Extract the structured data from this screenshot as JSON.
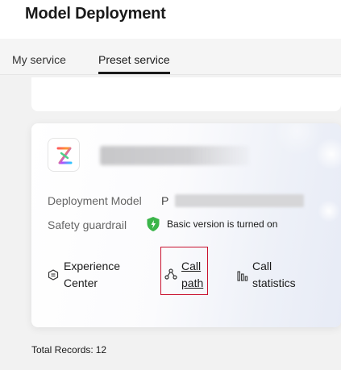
{
  "header": {
    "title": "Model Deployment"
  },
  "tabs": [
    {
      "label": "My service",
      "active": false
    },
    {
      "label": "Preset service",
      "active": true
    }
  ],
  "service_card": {
    "fields": {
      "deployment_model_label": "Deployment Model",
      "deployment_model_value_prefix": "P",
      "safety_guardrail_label": "Safety guardrail",
      "safety_guardrail_value": "Basic version is turned on"
    },
    "actions": [
      {
        "label": "Experience Center",
        "icon": "experience-icon"
      },
      {
        "label": "Call path",
        "icon": "call-path-icon"
      },
      {
        "label": "Call statistics",
        "icon": "bar-chart-icon"
      }
    ]
  },
  "footer": {
    "total_label": "Total Records:",
    "total_count": "12"
  },
  "colors": {
    "accent_outline": "#c8102e",
    "shield_green": "#3bb54a",
    "text_dark": "#1a1a1a"
  }
}
